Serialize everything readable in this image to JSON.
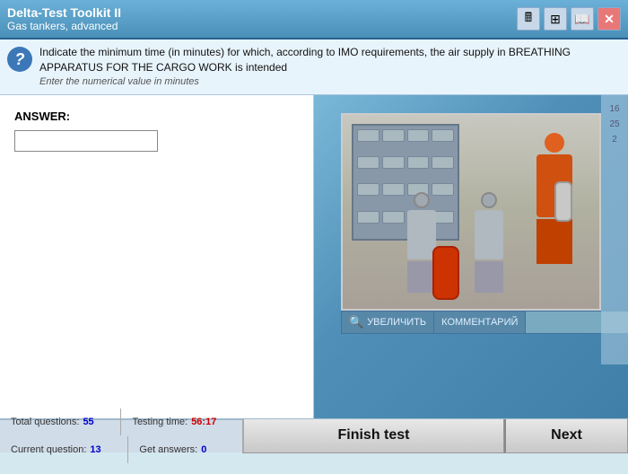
{
  "titleBar": {
    "appTitle": "Delta-Test Toolkit II",
    "subtitle": "Gas tankers, advanced",
    "icons": {
      "calculator": "🖩",
      "table": "⊞",
      "book": "📖",
      "close": "✕"
    }
  },
  "question": {
    "icon": "?",
    "mainText": "Indicate the minimum time (in minutes) for which, according to IMO requirements, the air supply in BREATHING APPARATUS FOR THE CARGO WORK is intended",
    "subText": "Enter the numerical value in minutes"
  },
  "answerSection": {
    "label": "ANSWER:",
    "inputPlaceholder": ""
  },
  "imageToolbar": {
    "zoom": "УВЕЛИЧИТЬ",
    "comment": "КОММЕНТАРИЙ",
    "searchPlaceholder": ""
  },
  "statusBar": {
    "totalQuestionsLabel": "Total questions:",
    "totalQuestionsValue": "55",
    "currentQuestionLabel": "Current question:",
    "currentQuestionValue": "13",
    "testingTimeLabel": "Testing time:",
    "testingTimeValue": "56:17",
    "getAnswersLabel": "Get answers:",
    "getAnswersValue": "0"
  },
  "buttons": {
    "finishTest": "Finish test",
    "next": "Next"
  }
}
